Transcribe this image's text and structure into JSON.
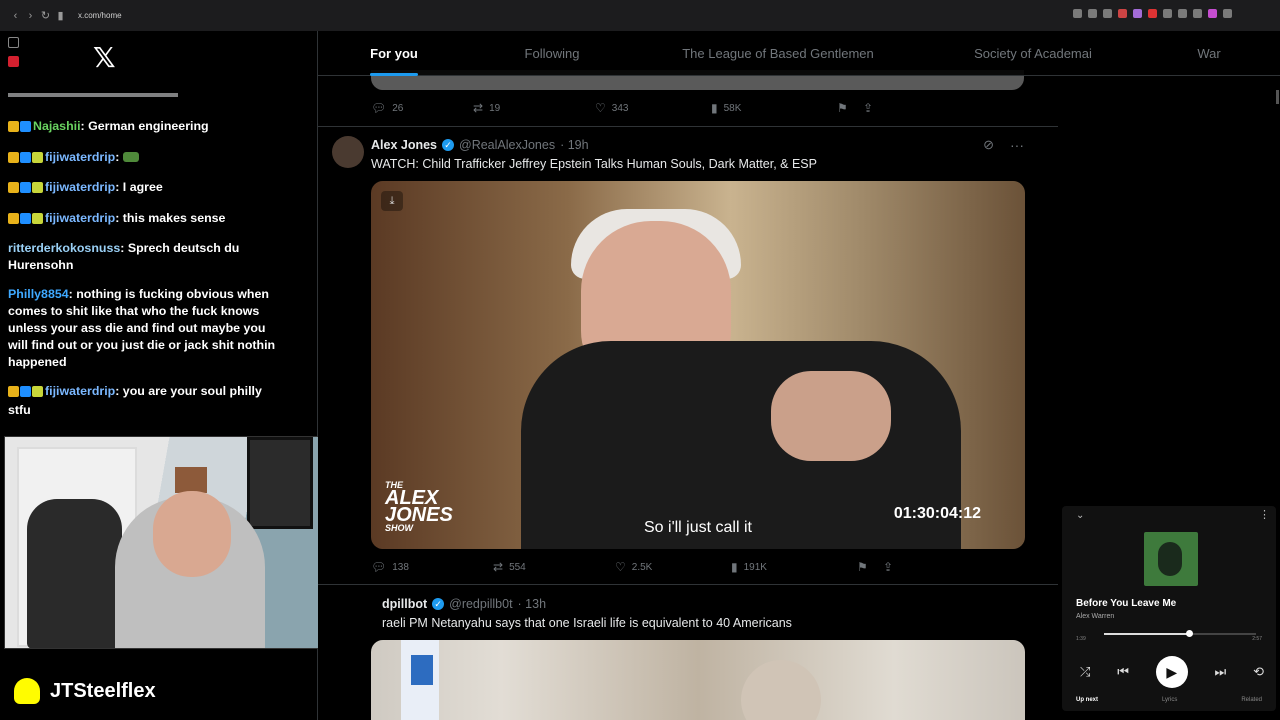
{
  "browser": {
    "url": "x.com/home"
  },
  "tabs": [
    "For you",
    "Following",
    "The League of Based Gentlemen",
    "Society of Academai",
    "War"
  ],
  "chat": {
    "messages": [
      {
        "user": "Najashii",
        "text": ": German engineering",
        "color": "#69d260",
        "badges": 2
      },
      {
        "user": "fijiwaterdrip",
        "text": ":",
        "color": "#7bb8ff",
        "badges": 3,
        "emote": true
      },
      {
        "user": "fijiwaterdrip",
        "text": ": I agree",
        "color": "#7bb8ff",
        "badges": 3
      },
      {
        "user": "fijiwaterdrip",
        "text": ": this makes sense",
        "color": "#7bb8ff",
        "badges": 3
      },
      {
        "user": "ritterderkokosnuss",
        "text": ": Sprech deutsch du Hurensohn",
        "color": "#9ad0f5",
        "badges": 0
      },
      {
        "user": "Philly8854",
        "text": ": nothing is fucking obvious when comes to shit like that who the fuck knows unless your ass die and find out maybe you will find out or you just die or jack shit nothin happened",
        "color": "#3fa9ff",
        "badges": 0
      },
      {
        "user": "fijiwaterdrip",
        "text": ": you are your soul philly stfu",
        "color": "#7bb8ff",
        "badges": 3
      }
    ]
  },
  "streamer": {
    "name": "JTSteelflex"
  },
  "feed": {
    "prev_actions": {
      "replies": "26",
      "reposts": "19",
      "likes": "343",
      "views": "58K"
    },
    "tweet": {
      "name": "Alex Jones",
      "handle": "@RealAlexJones",
      "time": "· 19h",
      "text": "WATCH: Child Trafficker Jeffrey Epstein Talks Human Souls, Dark Matter, & ESP",
      "video": {
        "logo_small": "THE",
        "logo_line1": "ALEX",
        "logo_line2": "JONES",
        "logo_show": "SHOW",
        "subtitle": "So i'll just call it",
        "timecode": "01:30:04:12"
      },
      "actions": {
        "replies": "138",
        "reposts": "554",
        "likes": "2.5K",
        "views": "191K"
      }
    },
    "tweet2": {
      "name": "dpillbot",
      "handle": "@redpillb0t",
      "time": "· 13h",
      "text": "raeli PM Netanyahu says that one Israeli life is equivalent to 40 Americans"
    }
  },
  "player": {
    "title": "Before You Leave Me",
    "artist": "Alex Warren",
    "elapsed": "1:39",
    "duration": "2:57",
    "progress": 0.56,
    "tabs": [
      "Up next",
      "Lyrics",
      "Related"
    ]
  }
}
